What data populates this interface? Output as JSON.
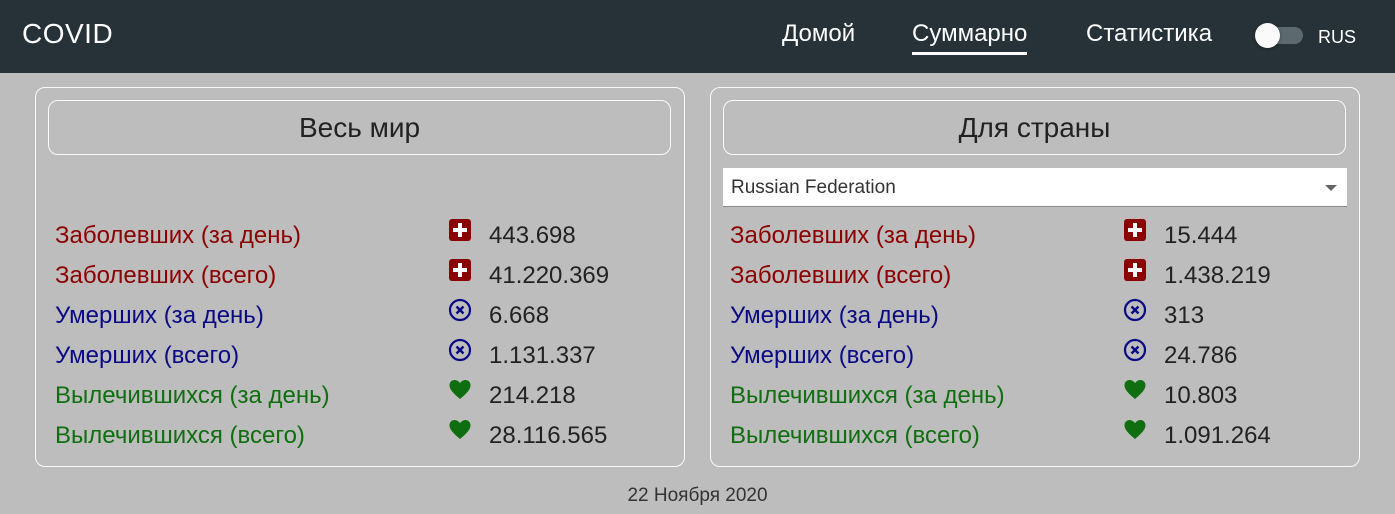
{
  "header": {
    "brand": "COVID",
    "nav": [
      {
        "label": "Домой",
        "active": false
      },
      {
        "label": "Суммарно",
        "active": true
      },
      {
        "label": "Статистика",
        "active": false
      }
    ],
    "language": "RUS"
  },
  "world": {
    "title": "Весь мир",
    "rows": [
      {
        "label": "Заболевших (за день)",
        "value": "443.698",
        "icon": "medical-cross-icon"
      },
      {
        "label": "Заболевших (всего)",
        "value": "41.220.369",
        "icon": "medical-cross-icon"
      },
      {
        "label": "Умерших (за день)",
        "value": "6.668",
        "icon": "circle-x-icon"
      },
      {
        "label": "Умерших (всего)",
        "value": "1.131.337",
        "icon": "circle-x-icon"
      },
      {
        "label": "Вылечившихся (за день)",
        "value": "214.218",
        "icon": "heart-icon"
      },
      {
        "label": "Вылечившихся (всего)",
        "value": "28.116.565",
        "icon": "heart-icon"
      }
    ]
  },
  "country": {
    "title": "Для страны",
    "selected_country": "Russian Federation",
    "rows": [
      {
        "label": "Заболевших (за день)",
        "value": "15.444",
        "icon": "medical-cross-icon"
      },
      {
        "label": "Заболевших (всего)",
        "value": "1.438.219",
        "icon": "medical-cross-icon"
      },
      {
        "label": "Умерших (за день)",
        "value": "313",
        "icon": "circle-x-icon"
      },
      {
        "label": "Умерших (всего)",
        "value": "24.786",
        "icon": "circle-x-icon"
      },
      {
        "label": "Вылечившихся (за день)",
        "value": "10.803",
        "icon": "heart-icon"
      },
      {
        "label": "Вылечившихся (всего)",
        "value": "1.091.264",
        "icon": "heart-icon"
      }
    ]
  },
  "colors": {
    "header_bg": "#263238",
    "page_bg": "#bdbdbd",
    "sick": "#8b0000",
    "dead": "#0a0a85",
    "recovered": "#0f6e0f"
  },
  "footer": {
    "date": "22 Ноября 2020"
  }
}
